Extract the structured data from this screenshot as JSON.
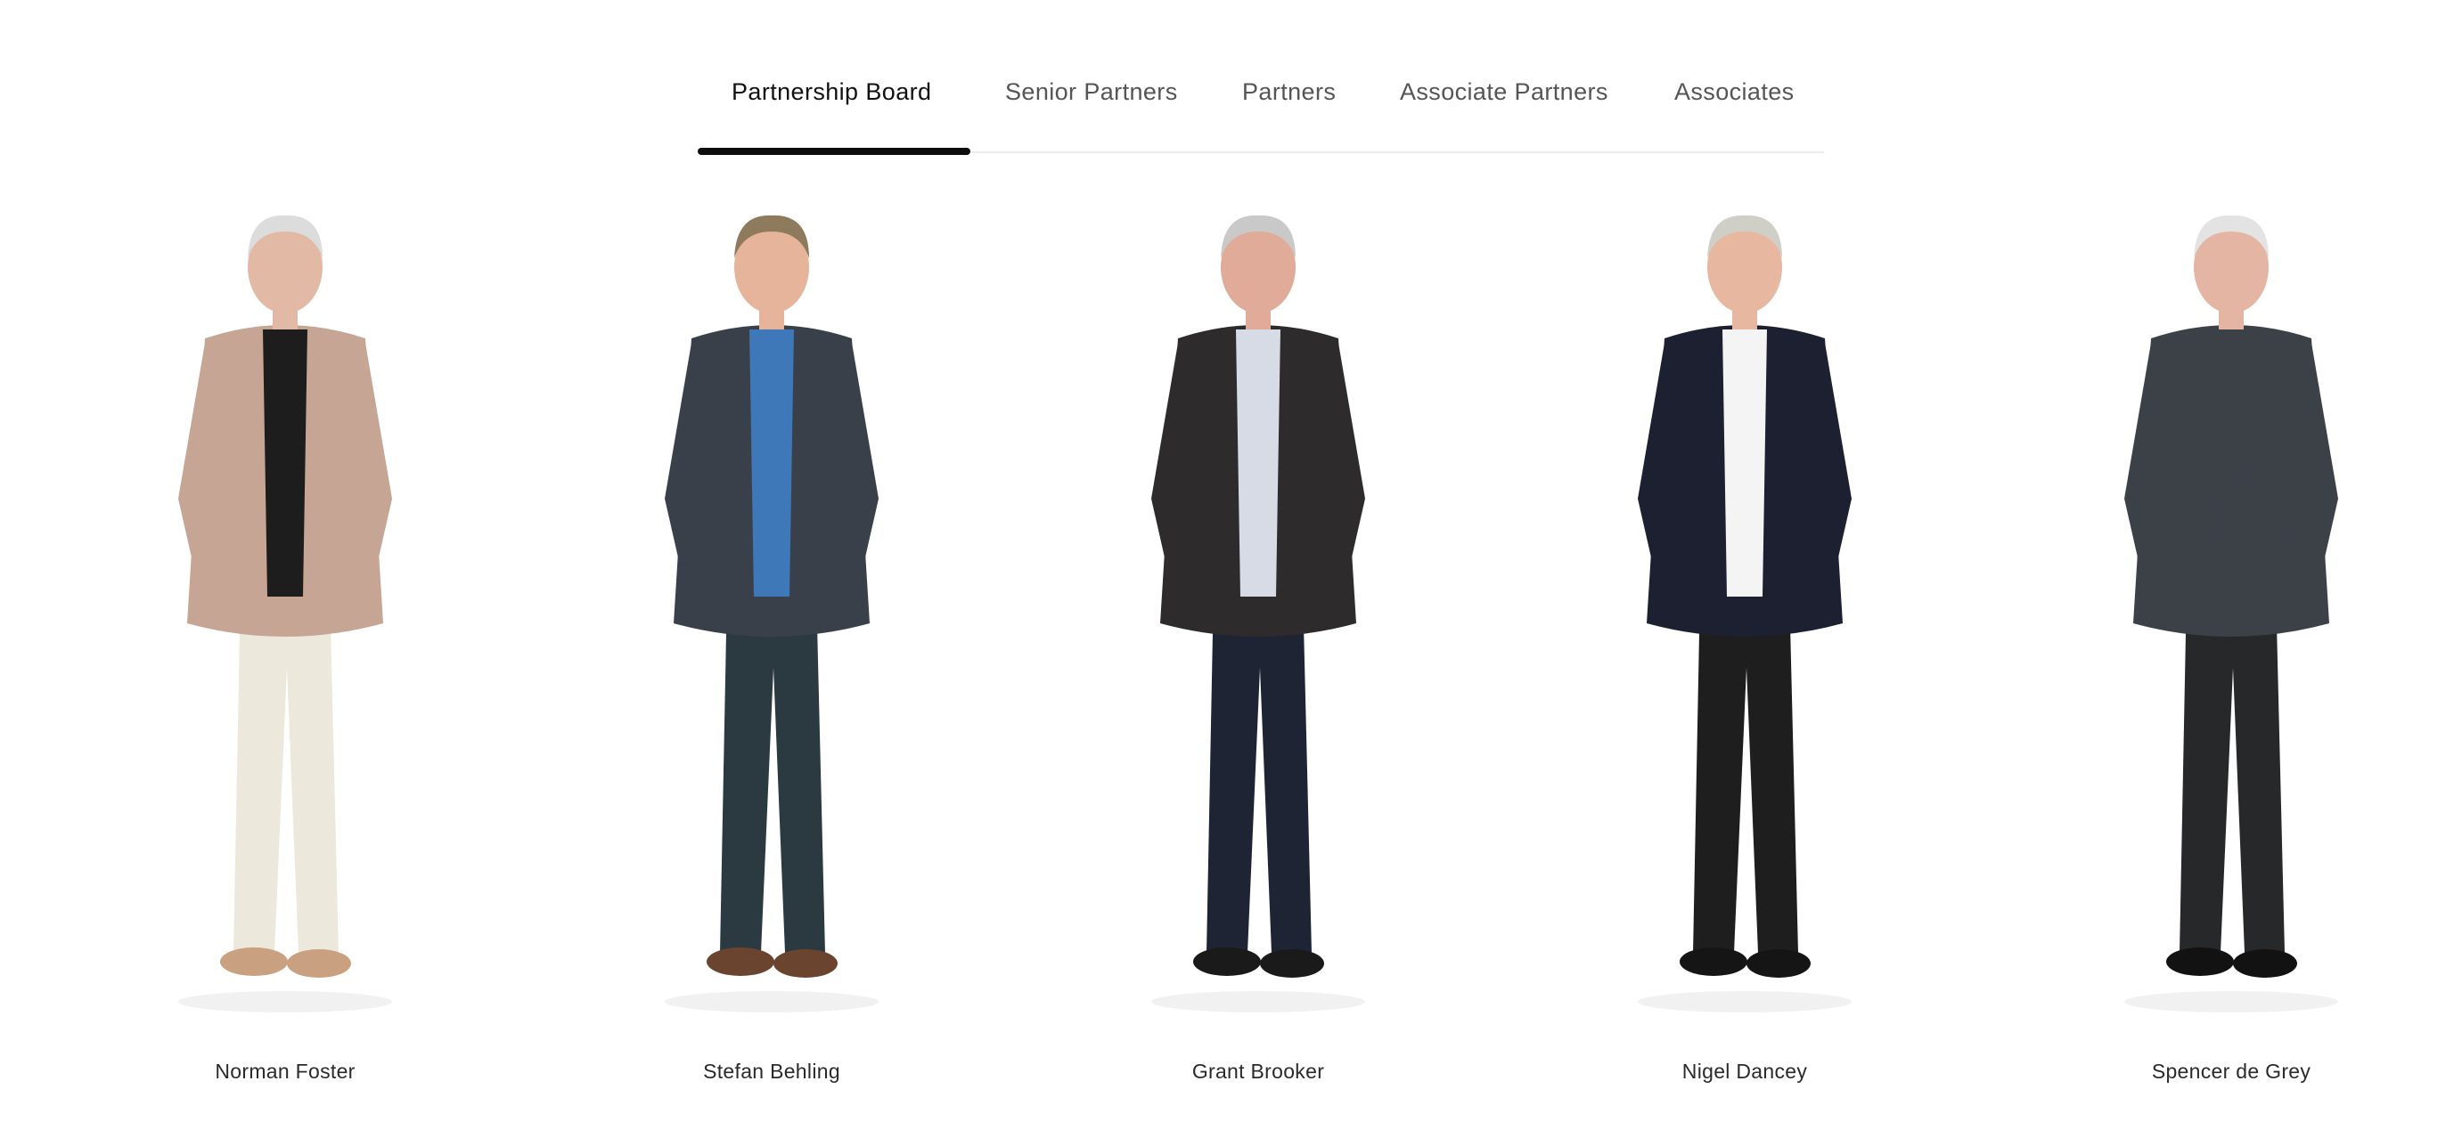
{
  "tabs": {
    "items": [
      {
        "label": "Partnership Board",
        "active": true
      },
      {
        "label": "Senior Partners",
        "active": false
      },
      {
        "label": "Partners",
        "active": false
      },
      {
        "label": "Associate Partners",
        "active": false
      },
      {
        "label": "Associates",
        "active": false
      }
    ]
  },
  "people": [
    {
      "name": "Norman Foster",
      "skin": "#e2b9a4",
      "hair": "#dcdcdc",
      "jacket": "#c7a594",
      "shirt": "#1d1d1d",
      "trousers": "#ece8dc",
      "shoes": "#c9a080"
    },
    {
      "name": "Stefan Behling",
      "skin": "#e6b49a",
      "hair": "#8e7a5c",
      "jacket": "#39404a",
      "shirt": "#3f78b8",
      "trousers": "#2b3a40",
      "shoes": "#6b4430"
    },
    {
      "name": "Grant Brooker",
      "skin": "#e0ab98",
      "hair": "#c9c9c9",
      "jacket": "#2d2b2c",
      "shirt": "#d7dbe6",
      "trousers": "#1f2435",
      "shoes": "#1a1a1a"
    },
    {
      "name": "Nigel Dancey",
      "skin": "#e8b7a0",
      "hair": "#cfcfc7",
      "jacket": "#1c2030",
      "shirt": "#f4f4f4",
      "trousers": "#1e1e1e",
      "shoes": "#151515"
    },
    {
      "name": "Spencer de Grey",
      "skin": "#e4b5a2",
      "hair": "#e3e3e3",
      "jacket": "#3c4148",
      "shirt": "#3c4148",
      "trousers": "#262829",
      "shoes": "#121212"
    }
  ]
}
